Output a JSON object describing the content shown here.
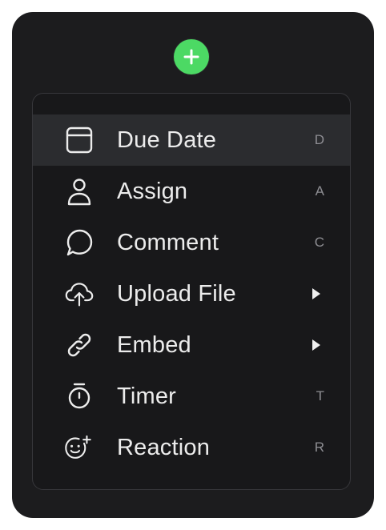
{
  "menu": {
    "items": [
      {
        "label": "Due Date",
        "icon": "calendar-icon",
        "shortcut": "D",
        "submenu": false,
        "active": true
      },
      {
        "label": "Assign",
        "icon": "person-icon",
        "shortcut": "A",
        "submenu": false,
        "active": false
      },
      {
        "label": "Comment",
        "icon": "comment-bubble-icon",
        "shortcut": "C",
        "submenu": false,
        "active": false
      },
      {
        "label": "Upload File",
        "icon": "cloud-upload-icon",
        "shortcut": "",
        "submenu": true,
        "active": false
      },
      {
        "label": "Embed",
        "icon": "link-icon",
        "shortcut": "",
        "submenu": true,
        "active": false
      },
      {
        "label": "Timer",
        "icon": "stopwatch-icon",
        "shortcut": "T",
        "submenu": false,
        "active": false
      },
      {
        "label": "Reaction",
        "icon": "emoji-add-icon",
        "shortcut": "R",
        "submenu": false,
        "active": false
      }
    ]
  },
  "add_button": {
    "icon": "plus-icon"
  },
  "colors": {
    "panel_background": "#1c1c1e",
    "menu_background": "#18181a",
    "active_row": "#2b2c2f",
    "accent_green": "#4cd964",
    "text": "#ececec",
    "shortcut_text": "#8e8e93"
  }
}
